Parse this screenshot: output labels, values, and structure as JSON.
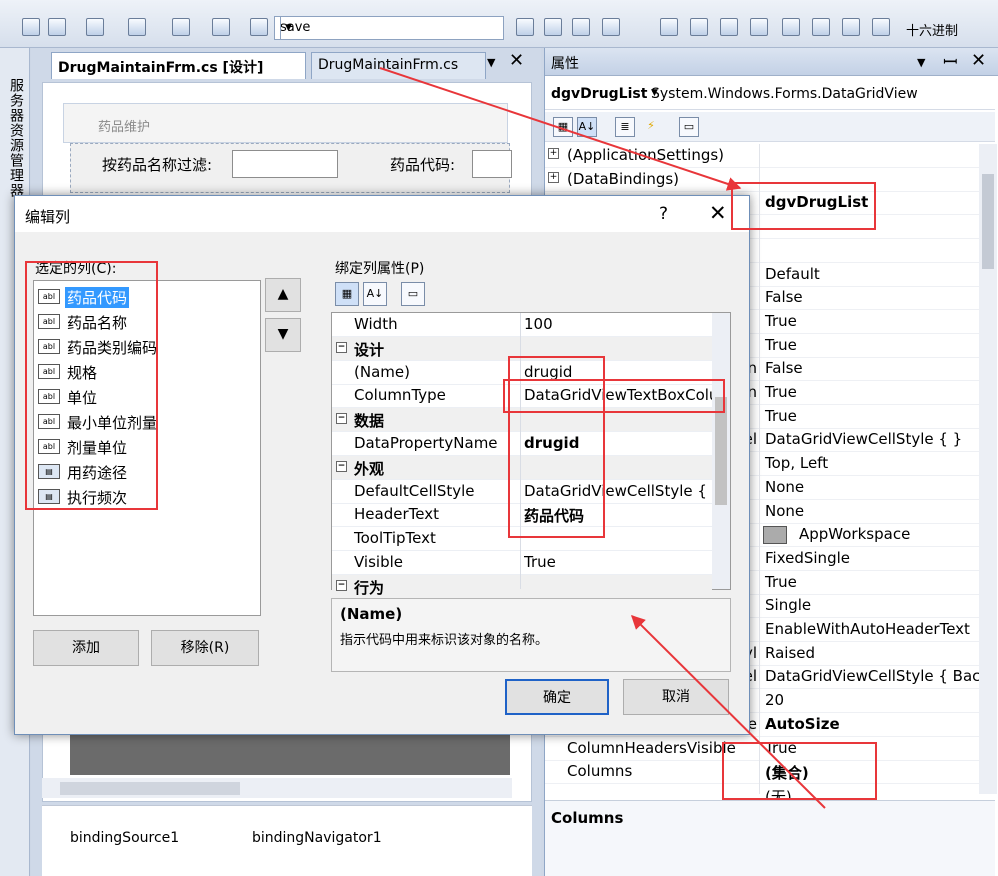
{
  "toolbar": {
    "combo_value": "save",
    "hex_label": "十六进制"
  },
  "left_strip": {
    "label": "服务器资源管理器"
  },
  "designer": {
    "tabs": [
      {
        "label": "DrugMaintainFrm.cs [设计]"
      },
      {
        "label": "DrugMaintainFrm.cs"
      }
    ],
    "form_title": "药品维护",
    "filter_label": "按药品名称过滤:",
    "code_label": "药品代码:",
    "components": [
      {
        "label": "bindingSource1"
      },
      {
        "label": "bindingNavigator1"
      }
    ]
  },
  "properties": {
    "title": "属性",
    "object_name": "dgvDrugList",
    "object_type": "System.Windows.Forms.DataGridView",
    "rows": [
      {
        "name": "(ApplicationSettings)",
        "value": ""
      },
      {
        "name": "(DataBindings)",
        "value": ""
      },
      {
        "name": "",
        "value": "dgvDrugList"
      },
      {
        "name": "",
        "value": ""
      },
      {
        "name": "",
        "value": ""
      },
      {
        "name": "",
        "value": "Default"
      },
      {
        "name": "",
        "value": "False"
      },
      {
        "name": "",
        "value": "True"
      },
      {
        "name": "",
        "value": "True"
      },
      {
        "name": "n",
        "value": "False"
      },
      {
        "name": "n",
        "value": "True"
      },
      {
        "name": "",
        "value": "True"
      },
      {
        "name": "el",
        "value": "DataGridViewCellStyle { }"
      },
      {
        "name": "",
        "value": "Top, Left"
      },
      {
        "name": "",
        "value": "None"
      },
      {
        "name": "",
        "value": "None"
      },
      {
        "name": "",
        "value": "AppWorkspace"
      },
      {
        "name": "",
        "value": "FixedSingle"
      },
      {
        "name": "",
        "value": "True"
      },
      {
        "name": "",
        "value": "Single"
      },
      {
        "name": "",
        "value": "EnableWithAutoHeaderText"
      },
      {
        "name": "yl",
        "value": "Raised"
      },
      {
        "name": "el",
        "value": "DataGridViewCellStyle { Back"
      },
      {
        "name": "",
        "value": "20"
      },
      {
        "name": "e",
        "value": "AutoSize"
      },
      {
        "name": "ColumnHeadersVisible",
        "value": "True"
      },
      {
        "name": "Columns",
        "value": "(集合)"
      },
      {
        "name": "",
        "value": "(无)"
      }
    ],
    "description_title": "Columns"
  },
  "dialog": {
    "title": "编辑列",
    "help": "?",
    "selected_columns_label": "选定的列(C):",
    "columns": [
      {
        "label": "药品代码",
        "icon": "abl"
      },
      {
        "label": "药品名称",
        "icon": "abl"
      },
      {
        "label": "药品类别编码",
        "icon": "abl"
      },
      {
        "label": "规格",
        "icon": "abl"
      },
      {
        "label": "单位",
        "icon": "abl"
      },
      {
        "label": "最小单位剂量",
        "icon": "abl"
      },
      {
        "label": "剂量单位",
        "icon": "abl"
      },
      {
        "label": "用药途径",
        "icon": "combo"
      },
      {
        "label": "执行频次",
        "icon": "combo"
      }
    ],
    "add_label": "添加",
    "remove_label": "移除(R)",
    "bound_props_label": "绑定列属性(P)",
    "grid_rows": [
      {
        "name": "Width",
        "value": "100"
      },
      {
        "name": "设计",
        "category": true
      },
      {
        "name": "(Name)",
        "value": "drugid"
      },
      {
        "name": "ColumnType",
        "value": "DataGridViewTextBoxColumn"
      },
      {
        "name": "数据",
        "category": true
      },
      {
        "name": "DataPropertyName",
        "value": "drugid"
      },
      {
        "name": "外观",
        "category": true
      },
      {
        "name": "DefaultCellStyle",
        "value": "DataGridViewCellStyle { }"
      },
      {
        "name": "HeaderText",
        "value": "药品代码"
      },
      {
        "name": "ToolTipText",
        "value": ""
      },
      {
        "name": "Visible",
        "value": "True"
      },
      {
        "name": "行为",
        "category": true
      }
    ],
    "desc_title": "(Name)",
    "desc_text": "指示代码中用来标识该对象的名称。",
    "ok_label": "确定",
    "cancel_label": "取消"
  },
  "colors": {
    "annotation": "#e8363a",
    "selection": "#3399ff"
  }
}
